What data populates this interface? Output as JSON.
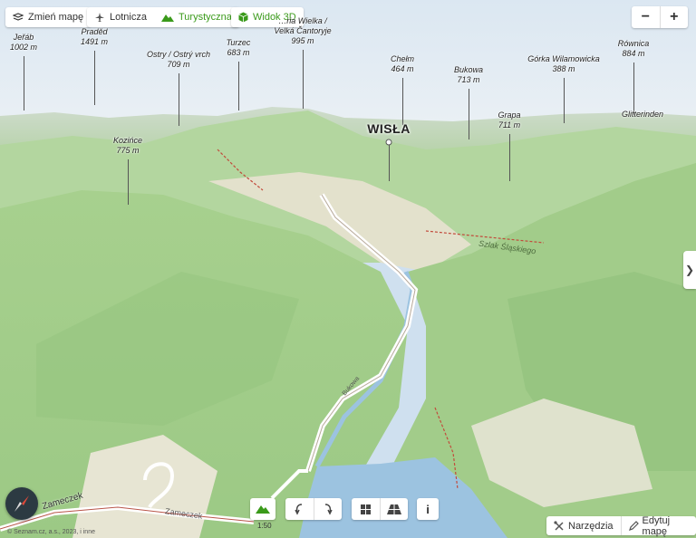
{
  "top_left": {
    "change_map": "Zmień mapę",
    "aviation": "Lotnicza",
    "tourist": "Turystyczna",
    "view3d": "Widok 3D"
  },
  "zoom": {
    "out": "−",
    "in": "+"
  },
  "side_toggle": "❯",
  "peaks": [
    {
      "name": "Jeřáb",
      "elev": "1002 m"
    },
    {
      "name": "Praděd",
      "elev": "1491 m"
    },
    {
      "name": "Ostry / Ostrý vrch",
      "elev": "709 m"
    },
    {
      "name": "Turzec",
      "elev": "683 m"
    },
    {
      "name": "…ria Wielka /",
      "name2": "Velká Čantoryje",
      "elev": "995 m"
    },
    {
      "name": "Chełm",
      "elev": "464 m"
    },
    {
      "name": "Bukowa",
      "elev": "713 m"
    },
    {
      "name": "Górka Wilamowicka",
      "elev": "388 m"
    },
    {
      "name": "Równica",
      "elev": "884 m"
    },
    {
      "name": "Kozińce",
      "elev": "775 m"
    },
    {
      "name": "Grapa",
      "elev": "711 m"
    },
    {
      "name": "Glitterinden",
      "elev": ""
    }
  ],
  "city": "WISŁA",
  "map_labels": {
    "road1": "Zameczek",
    "road2": "Zameczek",
    "road3": "Bukowa",
    "trail": "Szlak Śląskiego"
  },
  "bottom": {
    "terrain_scale": "1:50",
    "info": "i",
    "tools": "Narzędzia",
    "edit": "Edytuj mapę",
    "copyright": "© Seznam.cz, a.s., 2023, i inne"
  },
  "colors": {
    "accent_green": "#3a9a1a",
    "sky": "#d7e4f0",
    "terrain": "#a6d08e",
    "water": "#9cc3e0"
  }
}
